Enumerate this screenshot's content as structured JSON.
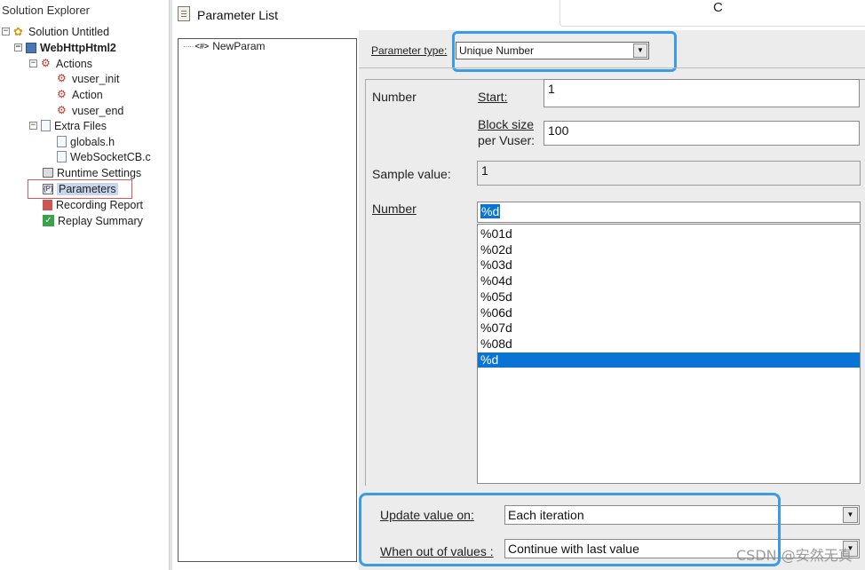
{
  "explorer": {
    "title": "Solution Explorer",
    "items": [
      {
        "label": "Solution Untitled"
      },
      {
        "label": "WebHttpHtml2"
      },
      {
        "label": "Actions"
      },
      {
        "label": "vuser_init"
      },
      {
        "label": "Action"
      },
      {
        "label": "vuser_end"
      },
      {
        "label": "Extra Files"
      },
      {
        "label": "globals.h"
      },
      {
        "label": "WebSocketCB.c"
      },
      {
        "label": "Runtime Settings"
      },
      {
        "label": "Parameters"
      },
      {
        "label": "Recording Report"
      },
      {
        "label": "Replay Summary"
      }
    ],
    "collapse_glyph": "⊟"
  },
  "topbar": {
    "title": "Parameter List",
    "refresh_glyph": "C"
  },
  "param_tree": {
    "tag": "<#>",
    "item": "NewParam"
  },
  "param_type": {
    "label": "Parameter type:",
    "value": "Unique Number"
  },
  "number": {
    "section_label": "Number",
    "start_label": "Start:",
    "start_value": "1",
    "block_label_1": "Block size",
    "block_label_2": "per Vuser:",
    "block_value": "100",
    "sample_label": "Sample value:",
    "sample_value": "1",
    "format_label": "Number",
    "format_value": "%d",
    "formats": [
      "%01d",
      "%02d",
      "%03d",
      "%04d",
      "%05d",
      "%06d",
      "%07d",
      "%08d",
      "%d"
    ],
    "selected_format_index": 8
  },
  "update": {
    "label": "Update value on:",
    "value": "Each iteration"
  },
  "out_of_values": {
    "label": "When out of values :",
    "value": "Continue with last value"
  },
  "watermark": "CSDN @安然无真",
  "colors": {
    "highlight_blue": "#3a9be8",
    "selection_blue": "#0a74d6",
    "red_outline": "#e05555"
  }
}
